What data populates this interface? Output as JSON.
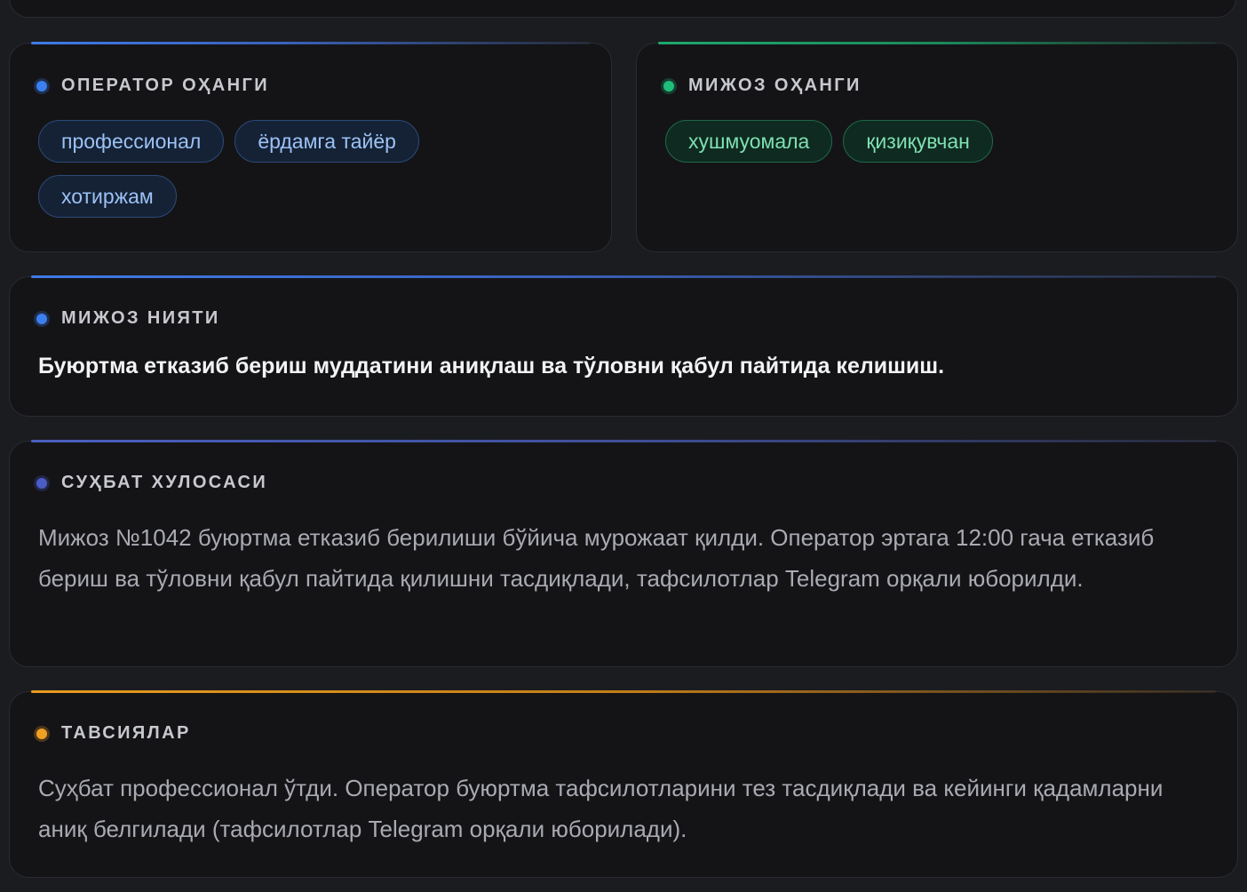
{
  "operator_tone": {
    "title": "ОПЕРАТОР ОҲАНГИ",
    "tags": [
      "профессионал",
      "ёрдамга тайёр",
      "хотиржам"
    ],
    "accent_color": "#3b7ff0"
  },
  "client_tone": {
    "title": "МИЖОЗ ОҲАНГИ",
    "tags": [
      "хушмуомала",
      "қизиқувчан"
    ],
    "accent_color": "#1fbf7a"
  },
  "client_intent": {
    "title": "МИЖОЗ НИЯТИ",
    "text": "Буюртма етказиб бериш муддатини аниқлаш ва тўловни қабул пайтида келишиш.",
    "accent_color": "#3b7ff0"
  },
  "summary": {
    "title": "СУҲБАТ ХУЛОСАСИ",
    "text": "Мижоз №1042 буюртма етказиб берилиши бўйича мурожаат қилди. Оператор эртага 12:00 гача етказиб бериш ва тўловни қабул пайтида қилишни тасдиқлади, тафсилотлар Telegram орқали юборилди.",
    "accent_color": "#4a5cc8"
  },
  "recommendations": {
    "title": "ТАВСИЯЛАР",
    "text": "Суҳбат профессионал ўтди. Оператор буюртма тафсилотларини тез тасдиқлади ва кейинги қадамларни аниқ белгилади (тафсилотлар Telegram орқали юборилади).",
    "accent_color": "#f0a023"
  }
}
